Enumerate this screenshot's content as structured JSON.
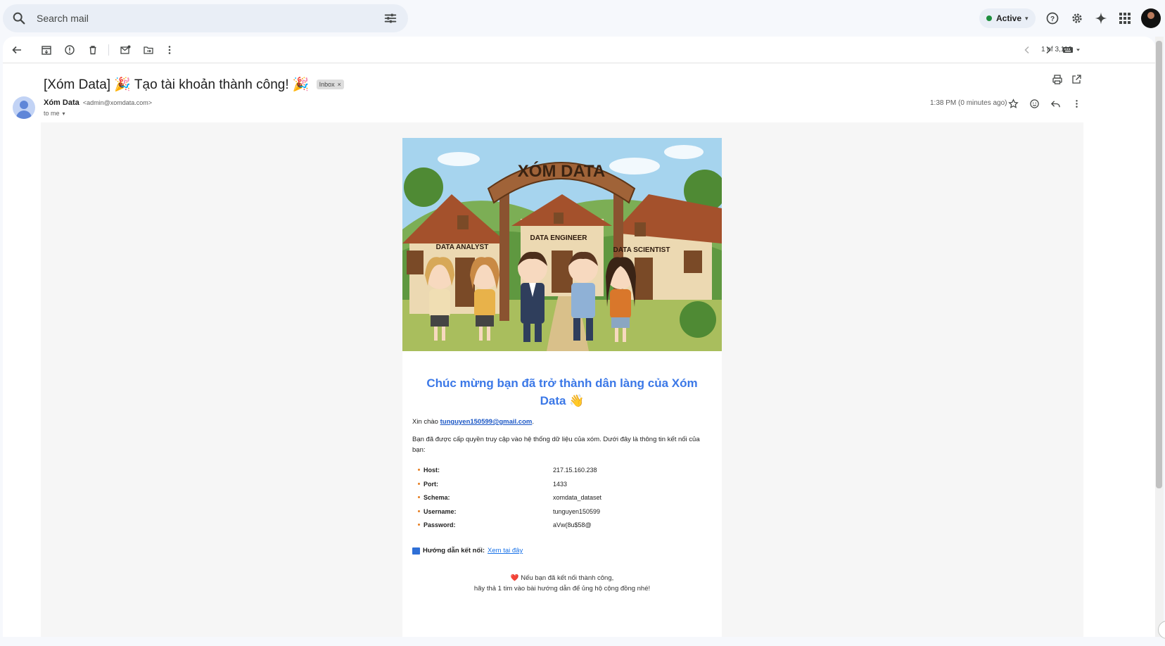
{
  "search": {
    "placeholder": "Search mail"
  },
  "status": {
    "label": "Active",
    "color": "#1e8e3e"
  },
  "toolbar": {
    "pager": "1 of 3,116"
  },
  "message": {
    "subject": "[Xóm Data] 🎉 Tạo tài khoản thành công! 🎉",
    "label": "Inbox",
    "label_close": "×",
    "sender_name": "Xóm Data",
    "sender_email": "<admin@xomdata.com>",
    "to": "to me",
    "time": "1:38 PM (0 minutes ago)"
  },
  "email": {
    "hero_sign": "XÓM DATA",
    "house_labels": [
      "DATA ANALYST",
      "DATA ENGINEER",
      "DATA SCIENTIST"
    ],
    "headline": "Chúc mừng bạn đã trở thành dân làng của Xóm Data 👋",
    "greeting_prefix": "Xin chào",
    "greeting_email": "tunguyen150599@gmail.com",
    "greeting_suffix": ".",
    "intro": "Bạn đã được cấp quyền truy cập vào hệ thống dữ liệu của xóm. Dưới đây là thông tin kết nối của bạn:",
    "details": [
      {
        "key": "Host:",
        "value": "217.15.160.238"
      },
      {
        "key": "Port:",
        "value": "1433"
      },
      {
        "key": "Schema:",
        "value": "xomdata_dataset"
      },
      {
        "key": "Username:",
        "value": "tunguyen150599"
      },
      {
        "key": "Password:",
        "value": "aVw(8u$58@"
      }
    ],
    "guide_label": "Hướng dẫn kết nối:",
    "guide_link": "Xem tại đây",
    "footer_line1": "Nếu bạn đã kết nối thành công,",
    "footer_heart": "❤️",
    "footer_line2": "hãy thả 1 tim vào bài hướng dẫn để ủng hộ cộng đồng nhé!"
  }
}
